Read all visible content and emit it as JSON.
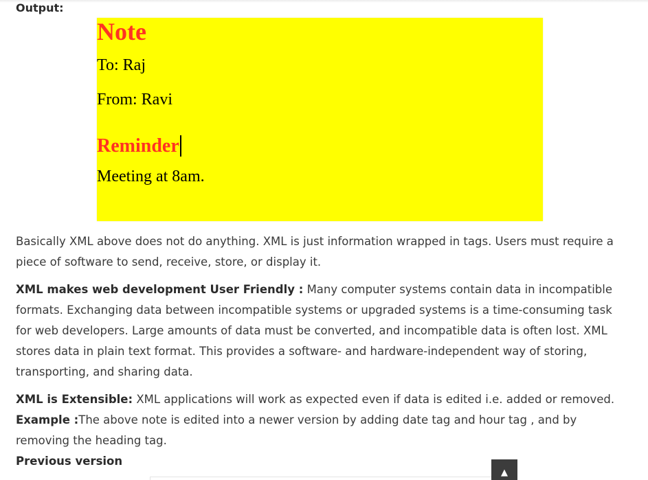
{
  "output_label": "Output:",
  "note": {
    "title": "Note",
    "to": "To: Raj",
    "from": "From: Ravi",
    "heading": "Reminder",
    "body": "Meeting at 8am."
  },
  "paragraphs": {
    "p1": "Basically XML above does not do anything. XML is just information wrapped in tags. Users must require a piece of software to send, receive, store, or display it.",
    "p2_bold": "XML makes web development User Friendly :",
    "p2_text": " Many computer systems contain data in incompatible formats. Exchanging data between incompatible systems or upgraded systems is a time-consuming task for web developers. Large amounts of data must be converted, and incompatible data is often lost. XML stores data in plain text format. This provides a software- and hardware-independent way of storing, transporting, and sharing data.",
    "p3_bold": "XML is Extensible:",
    "p3_text": " XML applications will work as expected even if data is edited i.e. added or removed.",
    "p3_example_bold": "Example :",
    "p3_example_text": "The above note is edited into a newer version by adding date tag and hour tag , and by removing the heading tag."
  },
  "previous_version_label": "Previous version",
  "scroll_top": {
    "icon": "arrow-up-icon",
    "glyph": "▲"
  },
  "colors": {
    "note_background": "#ffff00",
    "note_title": "#ff3322"
  }
}
